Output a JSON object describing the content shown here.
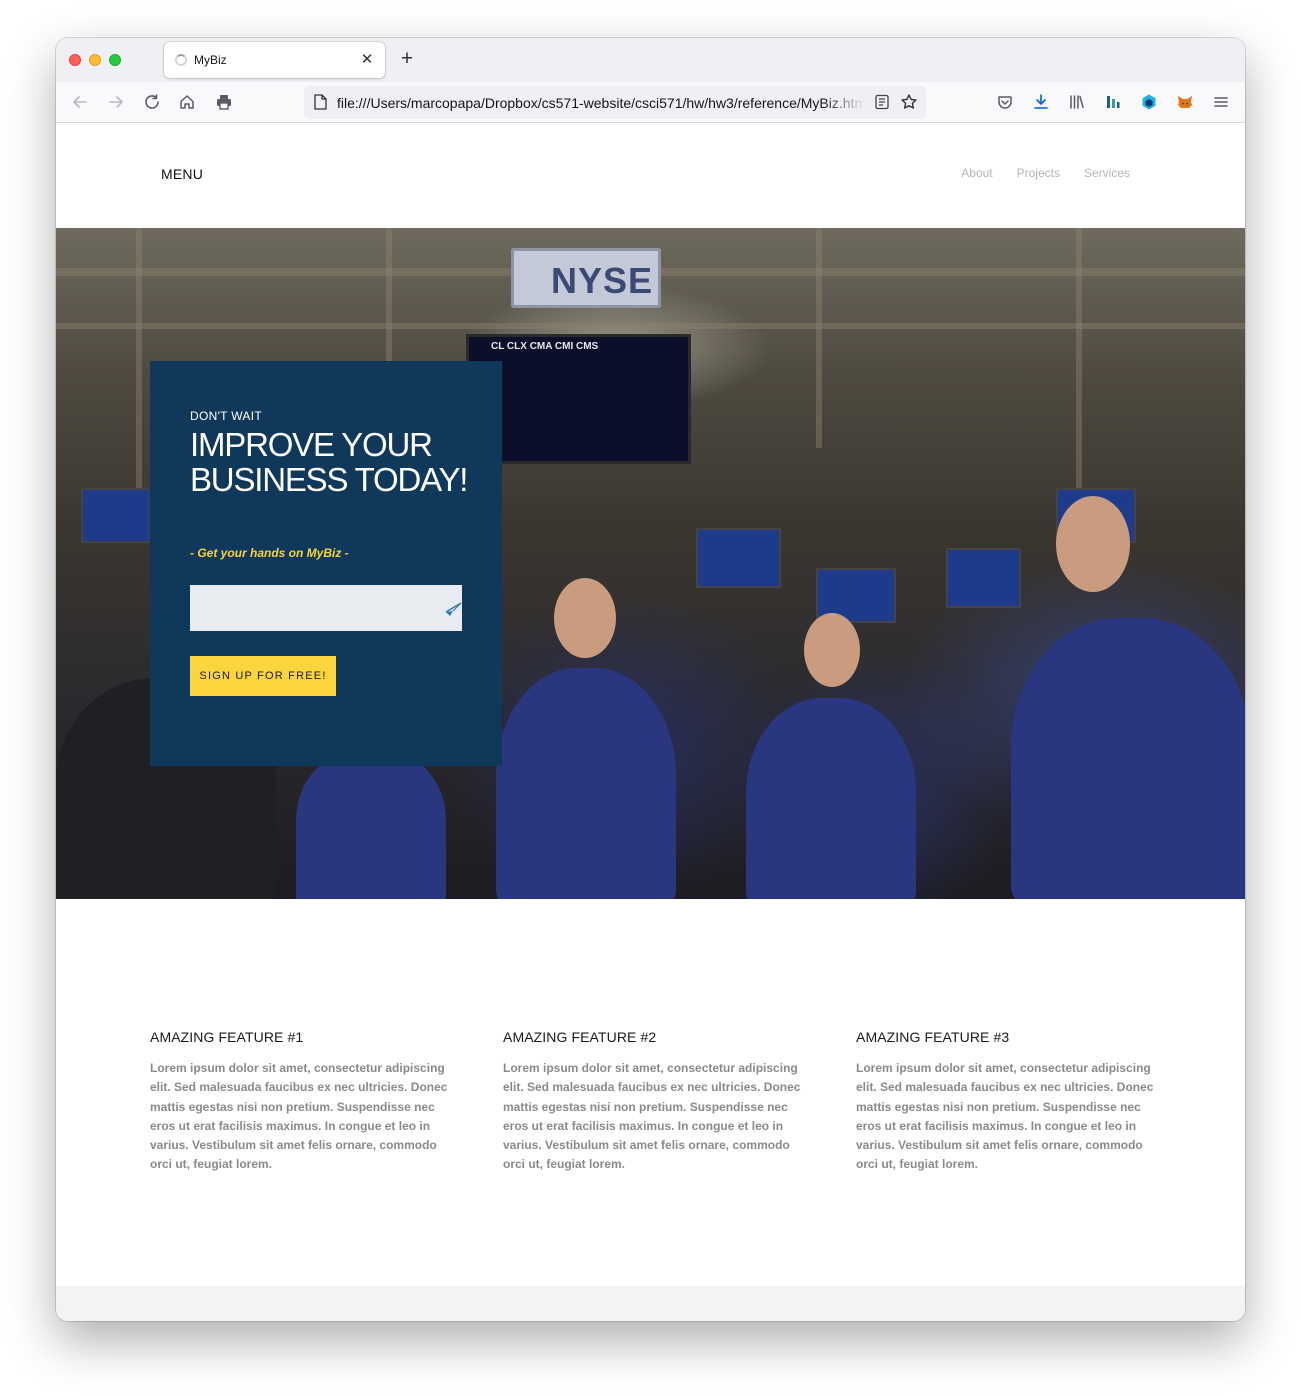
{
  "browser": {
    "tab_title": "MyBiz",
    "url": "file:///Users/marcopapa/Dropbox/cs571-website/csci571/hw/hw3/reference/MyBiz.html",
    "icons": [
      "back-arrow-icon",
      "forward-arrow-icon",
      "reload-icon",
      "home-icon",
      "print-icon",
      "page-icon",
      "reader-view-icon",
      "bookmark-star-icon",
      "pocket-icon",
      "downloads-icon",
      "library-icon",
      "extension-icon",
      "metamask-fox-icon",
      "hamburger-menu-icon"
    ]
  },
  "header": {
    "menu_label": "MENU",
    "nav": [
      "About",
      "Projects",
      "Services"
    ]
  },
  "hero": {
    "eyebrow": "DON'T WAIT",
    "headline": "IMPROVE YOUR BUSINESS TODAY!",
    "tagline": "- Get your hands on MyBiz -",
    "email_value": "",
    "cta_label": "SIGN UP FOR FREE!",
    "image_sign": "NYSE",
    "image_board": "CL  CLX  CMA  CMI  CMS",
    "colors": {
      "box": "#10385a",
      "accent": "#fad53d"
    }
  },
  "features": [
    {
      "title": "AMAZING FEATURE #1",
      "text": "Lorem ipsum dolor sit amet, consectetur adipiscing elit. Sed malesuada faucibus ex nec ultricies. Donec mattis egestas nisi non pretium. Suspendisse nec eros ut erat facilisis maximus. In congue et leo in varius. Vestibulum sit amet felis ornare, commodo orci ut, feugiat lorem."
    },
    {
      "title": "AMAZING FEATURE #2",
      "text": "Lorem ipsum dolor sit amet, consectetur adipiscing elit. Sed malesuada faucibus ex nec ultricies. Donec mattis egestas nisi non pretium. Suspendisse nec eros ut erat facilisis maximus. In congue et leo in varius. Vestibulum sit amet felis ornare, commodo orci ut, feugiat lorem."
    },
    {
      "title": "AMAZING FEATURE #3",
      "text": "Lorem ipsum dolor sit amet, consectetur adipiscing elit. Sed malesuada faucibus ex nec ultricies. Donec mattis egestas nisi non pretium. Suspendisse nec eros ut erat facilisis maximus. In congue et leo in varius. Vestibulum sit amet felis ornare, commodo orci ut, feugiat lorem."
    }
  ]
}
